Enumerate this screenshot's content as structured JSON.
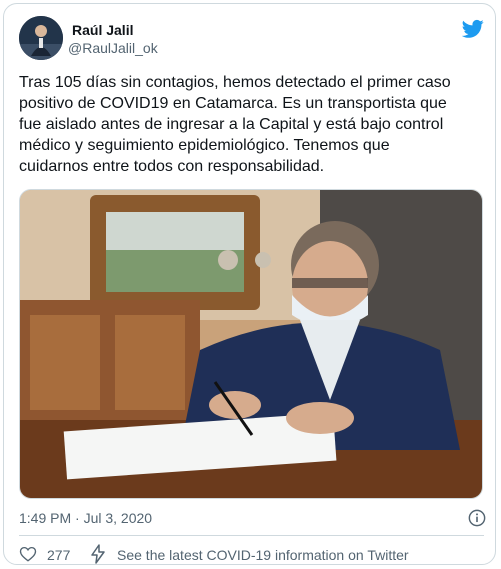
{
  "author": {
    "name": "Raúl Jalil",
    "handle": "@RaulJalil_ok"
  },
  "tweet": {
    "lines": [
      "Tras 105 días sin contagios, hemos detectado el primer caso",
      "positivo de COVID19 en Catamarca. Es un transportista que",
      "fue aislado antes de ingresar a la Capital y está bajo control",
      "médico y seguimiento epidemiológico. Tenemos que",
      "cuidarnos entre todos con responsabilidad."
    ]
  },
  "meta": {
    "timestamp": "1:49 PM · Jul 3, 2020",
    "likes": "277",
    "covid_link": "See the latest COVID-19 information on Twitter"
  },
  "colors": {
    "twitter_blue": "#1d9bf0",
    "muted_text": "#536471",
    "border": "#cfd9de"
  },
  "icons": {
    "brand": "twitter-bird-icon",
    "info": "info-icon",
    "like": "heart-icon",
    "covid": "lightning-icon"
  }
}
